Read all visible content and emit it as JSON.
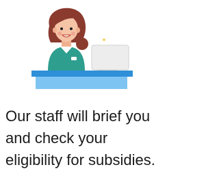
{
  "caption": {
    "lines": [
      "Our staff will brief you",
      "and check your",
      "eligibility for subsidies."
    ]
  },
  "illustration": {
    "icon": "receptionist-at-desk-icon",
    "colors": {
      "hair": "#8B3A2E",
      "skin": "#F5C4A6",
      "shirt": "#2E9E8F",
      "desk_top": "#2F8FD8",
      "desk_front": "#7EC4F2",
      "monitor": "#EDEDED",
      "sparkle": "#F2C94C"
    }
  }
}
